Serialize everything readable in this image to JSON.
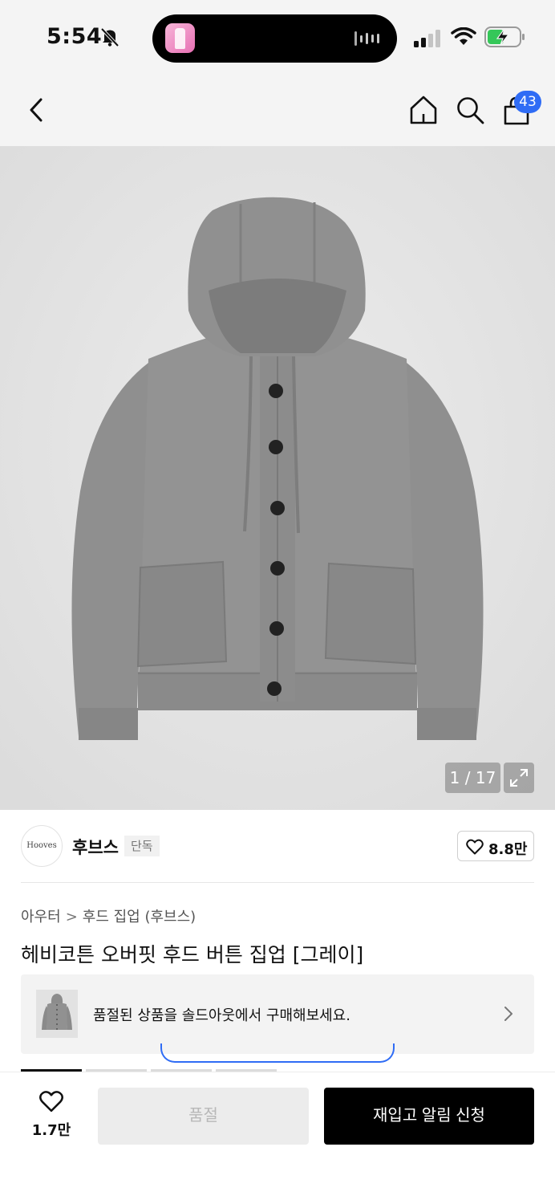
{
  "status_bar": {
    "time": "5:54",
    "icons": [
      "bell-slash-icon",
      "now-playing-thumbnail",
      "audio-wave-icon",
      "cellular-signal-icon",
      "wifi-icon",
      "battery-charging-icon"
    ]
  },
  "nav": {
    "icons": [
      "back-chevron-icon",
      "home-icon",
      "search-icon",
      "shopping-bag-icon"
    ],
    "cart_count": "43"
  },
  "gallery": {
    "counter": "1 / 17",
    "icons": [
      "expand-icon"
    ]
  },
  "brand": {
    "logo_text": "Hooves",
    "name": "후브스",
    "tag": "단독",
    "like_count": "8.8만",
    "icons": [
      "heart-outline-icon"
    ]
  },
  "breadcrumb": {
    "category": "아우터",
    "separator": ">",
    "subcategory": "후드 집업 (후브스)"
  },
  "product": {
    "title": "헤비코튼 오버핏 후드 버튼 집업 [그레이]"
  },
  "soldout_banner": {
    "text": "품절된 상품을 솔드아웃에서 구매해보세요."
  },
  "bottom_bar": {
    "like_count": "1.7만",
    "soldout_label": "품절",
    "restock_label": "재입고 알림 신청"
  },
  "colors": {
    "accent_blue": "#2f6cf5",
    "garment_gray": "#8e8e8e",
    "background_gray": "#f4f4f4"
  }
}
